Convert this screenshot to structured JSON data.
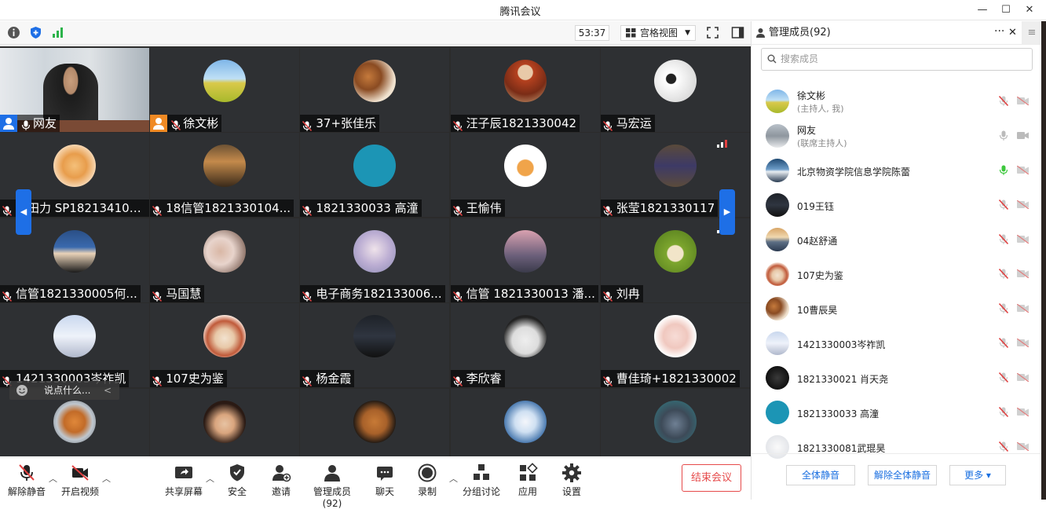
{
  "window": {
    "title": "腾讯会议",
    "min": "—",
    "max": "☐",
    "close": "✕"
  },
  "toolbar": {
    "timer": "53:37",
    "view_label": "宫格视图"
  },
  "colors": {
    "accent": "#1e6fe6",
    "end": "#e64a4a",
    "speaking": "#3cc83c",
    "muted": "#e04040"
  },
  "tiles": [
    {
      "name": "网友",
      "host": true,
      "video": true
    },
    {
      "name": "徐文彬",
      "host": true,
      "avatar": "field",
      "muted": true
    },
    {
      "name": "37+张佳乐",
      "avatar": "food",
      "muted": true
    },
    {
      "name": "汪子辰1821330042",
      "avatar": "boy",
      "muted": true
    },
    {
      "name": "马宏运",
      "avatar": "panda",
      "muted": true
    },
    {
      "name": "琚田力 SP182134100...",
      "avatar": "cat",
      "muted": true
    },
    {
      "name": "18信管1821330104...",
      "avatar": "dusk",
      "muted": true
    },
    {
      "name": "1821330033 高潼",
      "avatar": "teal",
      "muted": true
    },
    {
      "name": "王愉伟",
      "avatar": "shiba",
      "muted": true
    },
    {
      "name": "张莹1821330117",
      "avatar": "door",
      "muted": true,
      "signal": true
    },
    {
      "name": "信管1821330005何...",
      "avatar": "catsuit",
      "muted": true
    },
    {
      "name": "马国慧",
      "avatar": "girl",
      "muted": true
    },
    {
      "name": "电子商务182133006...",
      "avatar": "anime",
      "muted": true
    },
    {
      "name": "信管 1821330013 潘...",
      "avatar": "pink",
      "muted": true
    },
    {
      "name": "刘冉",
      "avatar": "green",
      "muted": true,
      "signal": true
    },
    {
      "name": "1421330003岑祚凯",
      "avatar": "snow",
      "muted": true
    },
    {
      "name": "107史为鉴",
      "avatar": "woman",
      "muted": true
    },
    {
      "name": "杨金霞",
      "avatar": "dark",
      "muted": true
    },
    {
      "name": "李欣睿",
      "avatar": "toy",
      "muted": true
    },
    {
      "name": "曹佳琦+1821330002",
      "avatar": "cartoon",
      "muted": true
    },
    {
      "name": "",
      "avatar": "hamster"
    },
    {
      "name": "",
      "avatar": "lady"
    },
    {
      "name": "",
      "avatar": "corgi"
    },
    {
      "name": "",
      "avatar": "flower"
    },
    {
      "name": "",
      "avatar": "man"
    }
  ],
  "chat_placeholder": "说点什么...",
  "chat_collapse": "<",
  "bottombar": {
    "unmute": "解除静音",
    "video": "开启视频",
    "share": "共享屏幕",
    "security": "安全",
    "invite": "邀请",
    "members": "管理成员(92)",
    "chat": "聊天",
    "record": "录制",
    "breakout": "分组讨论",
    "apps": "应用",
    "settings": "设置",
    "end": "结束会议"
  },
  "panel": {
    "title": "管理成员(92)",
    "search_placeholder": "搜索成员",
    "members": [
      {
        "name": "徐文彬",
        "sub": "(主持人, 我)",
        "avatar": "field",
        "mic": "muted"
      },
      {
        "name": "网友",
        "sub": "(联席主持人)",
        "avatar": "room",
        "mic": "off"
      },
      {
        "name": "北京物资学院信息学院陈蕾",
        "avatar": "ocean",
        "mic": "speaking"
      },
      {
        "name": "019王钰",
        "avatar": "dark",
        "mic": "muted"
      },
      {
        "name": "04赵舒通",
        "avatar": "sunset",
        "mic": "muted"
      },
      {
        "name": "107史为鉴",
        "avatar": "woman",
        "mic": "muted"
      },
      {
        "name": "10曹辰昊",
        "avatar": "food",
        "mic": "muted"
      },
      {
        "name": "1421330003岑祚凯",
        "avatar": "snow",
        "mic": "muted"
      },
      {
        "name": "1821330021 肖天尧",
        "avatar": "black",
        "mic": "muted"
      },
      {
        "name": "1821330033 高潼",
        "avatar": "teal",
        "mic": "muted"
      },
      {
        "name": "1821330081武琨昊",
        "avatar": "white",
        "mic": "muted"
      }
    ],
    "mute_all": "全体静音",
    "unmute_all": "解除全体静音",
    "more": "更多 ▾"
  }
}
